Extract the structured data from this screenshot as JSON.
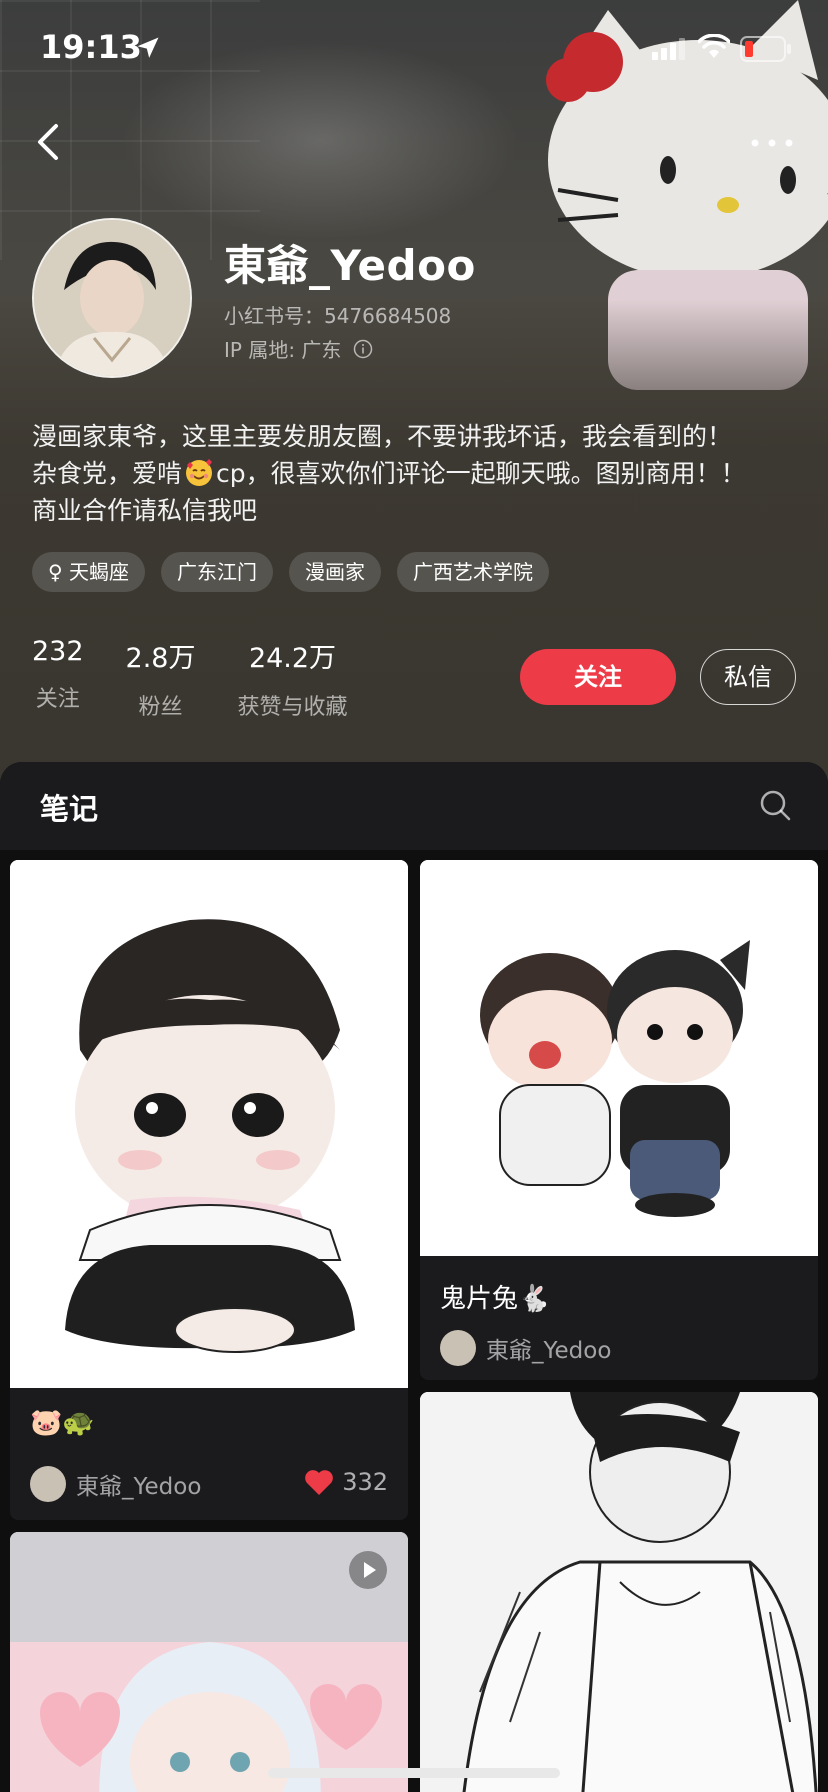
{
  "status_bar": {
    "time": "19:13"
  },
  "profile": {
    "name": "東爺_Yedoo",
    "id_label": "小红书号：5476684508",
    "ip_label": "IP 属地: 广东",
    "bio_lines": [
      {
        "text": "漫画家東爷，这里主要发朋友圈，不要讲我坏话，我会看到的！",
        "emoji_after": ""
      },
      {
        "before": "杂食党，爱啃",
        "emoji": "smiling-face-with-hearts",
        "after": "cp，很喜欢你们评论一起聊天哦。图别商用！！"
      },
      {
        "text": "商业合作请私信我吧"
      }
    ],
    "tags": [
      "♀ 天蝎座",
      "广东江门",
      "漫画家",
      "广西艺术学院"
    ],
    "stats": [
      {
        "value": "232",
        "label": "关注"
      },
      {
        "value": "2.8万",
        "label": "粉丝"
      },
      {
        "value": "24.2万",
        "label": "获赞与收藏"
      }
    ],
    "follow_label": "关注",
    "message_label": "私信"
  },
  "notes": {
    "tab_label": "笔记",
    "cards": [
      {
        "title": "🐷🐢",
        "author": "東爺_Yedoo",
        "likes": "332"
      },
      {
        "title": "鬼片兔🐇",
        "author": "東爺_Yedoo"
      },
      {
        "title": "",
        "author": "",
        "has_video": true
      },
      {
        "title": "",
        "author": ""
      }
    ]
  },
  "colors": {
    "accent": "#ee3b48",
    "panel": "#1b1b1e",
    "background": "#0f0f10"
  }
}
